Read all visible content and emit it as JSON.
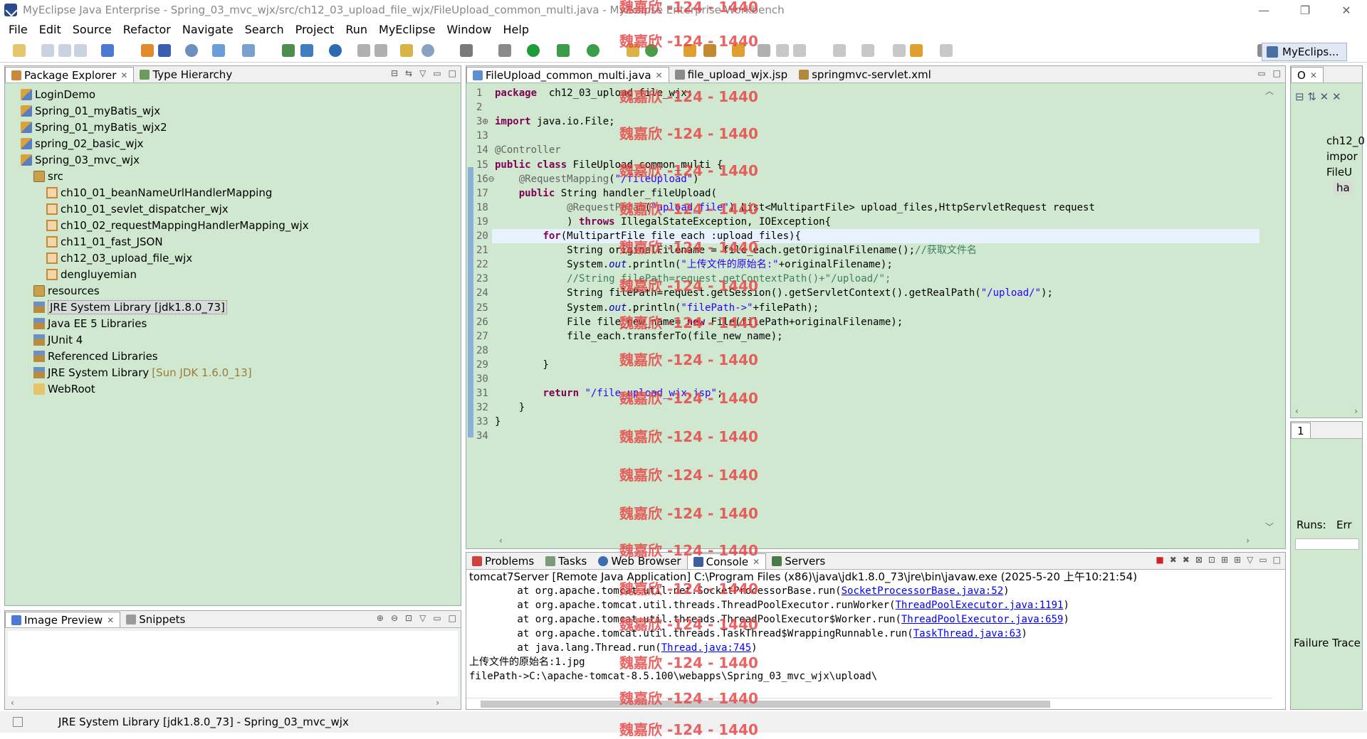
{
  "window": {
    "title": "MyEclipse Java Enterprise - Spring_03_mvc_wjx/src/ch12_03_upload_file_wjx/FileUpload_common_multi.java - MyEclipse Enterprise Workbench",
    "minimize": "—",
    "restore": "❐",
    "close": "✕"
  },
  "menu": [
    "File",
    "Edit",
    "Source",
    "Refactor",
    "Navigate",
    "Search",
    "Project",
    "Run",
    "MyEclipse",
    "Window",
    "Help"
  ],
  "perspective": {
    "label": "MyEclips..."
  },
  "package_explorer": {
    "tabs": [
      {
        "label": "Package Explorer",
        "close": "✕"
      },
      {
        "label": "Type Hierarchy"
      }
    ],
    "items": [
      {
        "label": "LoginDemo",
        "icon": "project-icon",
        "indent": 0
      },
      {
        "label": "Spring_01_myBatis_wjx",
        "icon": "project-icon",
        "indent": 0
      },
      {
        "label": "Spring_01_myBatis_wjx2",
        "icon": "project-icon",
        "indent": 0
      },
      {
        "label": "spring_02_basic_wjx",
        "icon": "project-icon",
        "indent": 0
      },
      {
        "label": "Spring_03_mvc_wjx",
        "icon": "project-icon",
        "indent": 0
      },
      {
        "label": "src",
        "icon": "source-folder-icon",
        "indent": 1
      },
      {
        "label": "ch10_01_beanNameUrlHandlerMapping",
        "icon": "package-icon",
        "indent": 2
      },
      {
        "label": "ch10_01_sevlet_dispatcher_wjx",
        "icon": "package-icon",
        "indent": 2
      },
      {
        "label": "ch10_02_requestMappingHandlerMapping_wjx",
        "icon": "package-icon",
        "indent": 2
      },
      {
        "label": "ch11_01_fast_JSON",
        "icon": "package-icon",
        "indent": 2
      },
      {
        "label": "ch12_03_upload_file_wjx",
        "icon": "package-icon",
        "indent": 2
      },
      {
        "label": "dengluyemian",
        "icon": "package-icon",
        "indent": 2
      },
      {
        "label": "resources",
        "icon": "source-folder-icon",
        "indent": 1
      },
      {
        "label": "JRE System Library [jdk1.8.0_73]",
        "icon": "library-icon",
        "indent": 1,
        "selected": true
      },
      {
        "label": "Java EE 5 Libraries",
        "icon": "library-icon",
        "indent": 1
      },
      {
        "label": "JUnit 4",
        "icon": "library-icon",
        "indent": 1
      },
      {
        "label": "Referenced Libraries",
        "icon": "library-icon",
        "indent": 1
      },
      {
        "label": "JRE System Library",
        "suffix": "[Sun JDK 1.6.0_13]",
        "icon": "library-icon",
        "indent": 1
      },
      {
        "label": "WebRoot",
        "icon": "folder-icon",
        "indent": 1
      }
    ]
  },
  "image_preview": {
    "tabs": [
      {
        "label": "Image Preview",
        "close": "✕"
      },
      {
        "label": "Snippets"
      }
    ]
  },
  "editor": {
    "tabs": [
      {
        "label": "FileUpload_common_multi.java",
        "close": "✕"
      },
      {
        "label": "file_upload_wjx.jsp"
      },
      {
        "label": "springmvc-servlet.xml"
      }
    ],
    "lines": [
      {
        "n": "1",
        "parts": [
          [
            "kw",
            "package"
          ],
          [
            "",
            "  ch12_03_upload_file_wjx;"
          ]
        ]
      },
      {
        "n": "2",
        "parts": []
      },
      {
        "n": "3⊕",
        "parts": [
          [
            "kw",
            "import"
          ],
          [
            "",
            " java.io.File;"
          ]
        ]
      },
      {
        "n": "13",
        "parts": []
      },
      {
        "n": "14",
        "parts": [
          [
            "ann",
            "@Controller"
          ]
        ]
      },
      {
        "n": "15",
        "parts": [
          [
            "kw",
            "public class"
          ],
          [
            "",
            " FileUpload_common_multi {"
          ]
        ]
      },
      {
        "n": "16⊖",
        "parts": [
          [
            "",
            "    "
          ],
          [
            "ann",
            "@RequestMapping"
          ],
          [
            "",
            "("
          ],
          [
            "str",
            "\"/fileUpload\""
          ],
          [
            "",
            ")"
          ]
        ]
      },
      {
        "n": "17",
        "parts": [
          [
            "",
            "    "
          ],
          [
            "kw",
            "public"
          ],
          [
            "",
            " String handler_fileUpload("
          ]
        ]
      },
      {
        "n": "18",
        "parts": [
          [
            "",
            "            "
          ],
          [
            "ann",
            "@RequestParam"
          ],
          [
            "",
            "("
          ],
          [
            "str",
            "\"upload_file\""
          ],
          [
            "",
            ") List<MultipartFile> upload_files,HttpServletRequest request"
          ]
        ]
      },
      {
        "n": "19",
        "parts": [
          [
            "",
            "            ) "
          ],
          [
            "kw",
            "throws"
          ],
          [
            "",
            " IllegalStateException, IOException{"
          ]
        ]
      },
      {
        "n": "20",
        "parts": [
          [
            "",
            "        "
          ],
          [
            "kw",
            "for"
          ],
          [
            "",
            "(MultipartFile file_each :upload_files){"
          ]
        ],
        "highlight": true
      },
      {
        "n": "21",
        "parts": [
          [
            "",
            "            String originalFilename = file_each.getOriginalFilename();"
          ],
          [
            "cmt",
            "//获取文件名"
          ]
        ]
      },
      {
        "n": "22",
        "parts": [
          [
            "",
            "            System."
          ],
          [
            "fld",
            "out"
          ],
          [
            "",
            ".println("
          ],
          [
            "str",
            "\"上传文件的原始名:\""
          ],
          [
            "",
            "+originalFilename);"
          ]
        ]
      },
      {
        "n": "23",
        "parts": [
          [
            "",
            "            "
          ],
          [
            "cmt",
            "//String filePath=request.getContextPath()+\"/upload/\";"
          ]
        ]
      },
      {
        "n": "24",
        "parts": [
          [
            "",
            "            String filePath=request.getSession().getServletContext().getRealPath("
          ],
          [
            "str",
            "\"/upload/\""
          ],
          [
            "",
            ");"
          ]
        ]
      },
      {
        "n": "25",
        "parts": [
          [
            "",
            "            System."
          ],
          [
            "fld",
            "out"
          ],
          [
            "",
            ".println("
          ],
          [
            "str",
            "\"filePath->\""
          ],
          [
            "",
            "+filePath);"
          ]
        ]
      },
      {
        "n": "26",
        "parts": [
          [
            "",
            "            File file_new_name= "
          ],
          [
            "kw",
            "new"
          ],
          [
            "",
            " File(filePath+originalFilename);"
          ]
        ]
      },
      {
        "n": "27",
        "parts": [
          [
            "",
            "            file_each.transferTo(file_new_name);"
          ]
        ]
      },
      {
        "n": "28",
        "parts": []
      },
      {
        "n": "29",
        "parts": [
          [
            "",
            "        }"
          ]
        ]
      },
      {
        "n": "30",
        "parts": []
      },
      {
        "n": "31",
        "parts": [
          [
            "",
            "        "
          ],
          [
            "kw",
            "return"
          ],
          [
            "",
            " "
          ],
          [
            "str",
            "\"/file_upload_wjx.jsp\""
          ],
          [
            "",
            ";"
          ]
        ]
      },
      {
        "n": "32",
        "parts": [
          [
            "",
            "    }"
          ]
        ]
      },
      {
        "n": "33",
        "parts": [
          [
            "",
            "}"
          ]
        ]
      },
      {
        "n": "34",
        "parts": []
      }
    ]
  },
  "console": {
    "tabs": [
      {
        "label": "Problems"
      },
      {
        "label": "Tasks"
      },
      {
        "label": "Web Browser"
      },
      {
        "label": "Console",
        "close": "✕"
      },
      {
        "label": "Servers"
      }
    ],
    "launch": "tomcat7Server [Remote Java Application] C:\\Program Files (x86)\\java\\jdk1.8.0_73\\jre\\bin\\javaw.exe (2025-5-20 上午10:21:54)",
    "lines": [
      {
        "text": "        at org.apache.tomcat.util.net.SocketProcessorBase.run(",
        "link": "SocketProcessorBase.java:52",
        "tail": ")"
      },
      {
        "text": "        at org.apache.tomcat.util.threads.ThreadPoolExecutor.runWorker(",
        "link": "ThreadPoolExecutor.java:1191",
        "tail": ")"
      },
      {
        "text": "        at org.apache.tomcat.util.threads.ThreadPoolExecutor$Worker.run(",
        "link": "ThreadPoolExecutor.java:659",
        "tail": ")"
      },
      {
        "text": "        at org.apache.tomcat.util.threads.TaskThread$WrappingRunnable.run(",
        "link": "TaskThread.java:63",
        "tail": ")"
      },
      {
        "text": "        at java.lang.Thread.run(",
        "link": "Thread.java:745",
        "tail": ")"
      },
      {
        "text": "上传文件的原始名:1.jpg"
      },
      {
        "text": "filePath->C:\\apache-tomcat-8.5.100\\webapps\\Spring_03_mvc_wjx\\upload\\"
      }
    ]
  },
  "outline": {
    "tab_label": "O",
    "items": [
      "ch12_0",
      "impor",
      "FileU",
      "ha"
    ]
  },
  "junit": {
    "tab_label": "1",
    "runs_label": "Runs:",
    "err_label": "Err",
    "failure_trace": "Failure Trace"
  },
  "status": {
    "text": "JRE System Library [jdk1.8.0_73] - Spring_03_mvc_wjx"
  },
  "watermark": {
    "text": "魏嘉欣 -124 - 1440"
  },
  "colors": {
    "panel_bg": "#cfe8cf",
    "keyword": "#7f0055",
    "string": "#2a00ff",
    "comment": "#3f7f5f",
    "watermark": "#e84848"
  }
}
